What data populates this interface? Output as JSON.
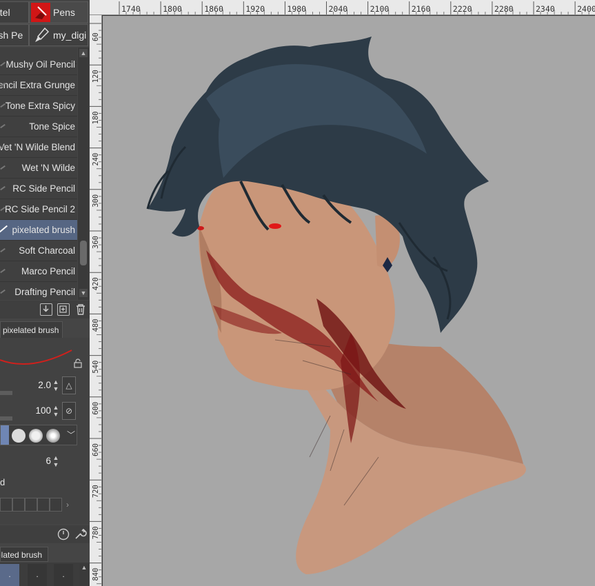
{
  "sub_tool_tabs": {
    "pastel": "astel",
    "pens": "Pens",
    "brush": "rush Pe",
    "my_digi": "my_digi"
  },
  "brushes": [
    {
      "name": "Mushy Oil Pencil"
    },
    {
      "name": "Pencil Extra Grunge",
      "visible": "encil Extra Grunge"
    },
    {
      "name": "Tone Extra Spicy"
    },
    {
      "name": "Tone Spice"
    },
    {
      "name": "Wet 'N Wilde Blend",
      "visible": "Vet 'N Wilde Blend"
    },
    {
      "name": "Wet 'N Wilde"
    },
    {
      "name": "RC Side Pencil"
    },
    {
      "name": "RC Side Pencil 2"
    },
    {
      "name": "pixelated brush",
      "selected": true
    },
    {
      "name": "Soft Charcoal"
    },
    {
      "name": "Marco Pencil"
    },
    {
      "name": "Drafting Pencil"
    }
  ],
  "tool_property": {
    "header": "pixelated brush",
    "brush_size": "2.0",
    "opacity": "100",
    "density": "6",
    "label_d": "d"
  },
  "bottom_panel": {
    "tab_label": "elated brush"
  },
  "ruler": {
    "horizontal": [
      "1740",
      "1800",
      "1860",
      "1920",
      "1980",
      "2040",
      "2100",
      "2160",
      "2220",
      "2280",
      "2340",
      "2400"
    ],
    "vertical": [
      "60",
      "120",
      "180",
      "240",
      "300",
      "360",
      "420",
      "480",
      "540",
      "600",
      "660",
      "720",
      "780",
      "840"
    ]
  },
  "colors": {
    "panel": "#454545",
    "selected_item": "#566683",
    "canvas": "#a7a7a7",
    "pens_icon": "#d11616",
    "curve": "#d0201c"
  },
  "canvas_content": {
    "artwork": "painted portrait"
  }
}
